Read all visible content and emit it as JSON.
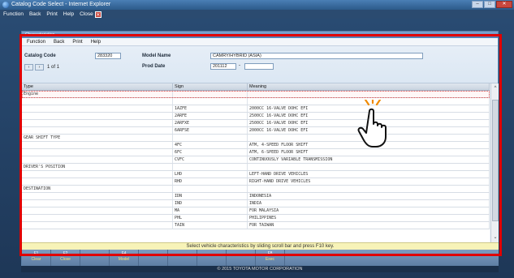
{
  "browser": {
    "title": "Catalog Code Select - Internet Explorer",
    "menu": [
      "Function",
      "Back",
      "Print",
      "Help"
    ],
    "close_label": "Close"
  },
  "app": {
    "caption": "Characteristics",
    "menu": [
      "Function",
      "Back",
      "Print",
      "Help"
    ],
    "catalog_code_label": "Catalog Code",
    "catalog_code_value": "283320",
    "model_name_label": "Model Name",
    "model_name_value": "CAMRY/HYBRID (ASIA)",
    "prod_date_label": "Prod Date",
    "prod_date_value": "201112",
    "prod_date_to_value": "",
    "prod_date_separator": "-",
    "pager": {
      "current": "1",
      "of_label": "of",
      "total": "1"
    }
  },
  "table": {
    "headers": [
      "Type",
      "Sign",
      "Meaning"
    ],
    "rows": [
      {
        "type": "Engine",
        "sign": "",
        "meaning": "",
        "kind": "group",
        "selected": true
      },
      {
        "type": "",
        "sign": "",
        "meaning": "",
        "kind": "item"
      },
      {
        "type": "",
        "sign": "1AZFE",
        "meaning": "2000CC 16-VALVE DOHC EFI",
        "kind": "item"
      },
      {
        "type": "",
        "sign": "2ARFE",
        "meaning": "2500CC 16-VALVE DOHC EFI",
        "kind": "item"
      },
      {
        "type": "",
        "sign": "2ARFXE",
        "meaning": "2500CC 16-VALVE DOHC EFI",
        "kind": "item"
      },
      {
        "type": "",
        "sign": "6ARFSE",
        "meaning": "2000CC 16-VALVE DOHC EFI",
        "kind": "item"
      },
      {
        "type": "GEAR SHIFT TYPE",
        "sign": "",
        "meaning": "",
        "kind": "group"
      },
      {
        "type": "",
        "sign": "4FC",
        "meaning": "ATM, 4-SPEED FLOOR SHIFT",
        "kind": "item"
      },
      {
        "type": "",
        "sign": "6FC",
        "meaning": "ATM, 6-SPEED FLOOR SHIFT",
        "kind": "item"
      },
      {
        "type": "",
        "sign": "CVFC",
        "meaning": "CONTINUOUSLY VARIABLE TRANSMISSION",
        "kind": "item"
      },
      {
        "type": "DRIVER'S POSITION",
        "sign": "",
        "meaning": "",
        "kind": "group"
      },
      {
        "type": "",
        "sign": "LHD",
        "meaning": "LEFT-HAND DRIVE VEHICLES",
        "kind": "item"
      },
      {
        "type": "",
        "sign": "RHD",
        "meaning": "RIGHT-HAND DRIVE VEHICLES",
        "kind": "item"
      },
      {
        "type": "DESTINATION",
        "sign": "",
        "meaning": "",
        "kind": "group"
      },
      {
        "type": "",
        "sign": "IDN",
        "meaning": "INDONESIA",
        "kind": "item"
      },
      {
        "type": "",
        "sign": "IND",
        "meaning": "INDIA",
        "kind": "item"
      },
      {
        "type": "",
        "sign": "MA",
        "meaning": "FOR MALAYSIA",
        "kind": "item"
      },
      {
        "type": "",
        "sign": "PHL",
        "meaning": "PHILIPPINES",
        "kind": "item"
      },
      {
        "type": "",
        "sign": "TAIN",
        "meaning": "FOR TAIWAN",
        "kind": "item"
      }
    ]
  },
  "status_message": "Select vehicle characteristics by sliding scroll bar and press F10 key.",
  "fkeys": [
    {
      "key": "F1",
      "name": "Clear"
    },
    {
      "key": "F2",
      "name": "Close"
    },
    {
      "key": "",
      "name": ""
    },
    {
      "key": "F4",
      "name": "Model"
    },
    {
      "key": "",
      "name": ""
    },
    {
      "key": "",
      "name": ""
    },
    {
      "key": "",
      "name": ""
    },
    {
      "key": "",
      "name": ""
    },
    {
      "key": "F8",
      "name": "Exec"
    }
  ],
  "copyright": "© 2015 TOYOTA MOTOR CORPORATION",
  "colors": {
    "highlight_frame": "#e10000",
    "status_bg": "#f7f3b8",
    "fkey_bar": "#6c8bb0"
  },
  "icons": {
    "cursor": "hand-pointer-icon"
  }
}
